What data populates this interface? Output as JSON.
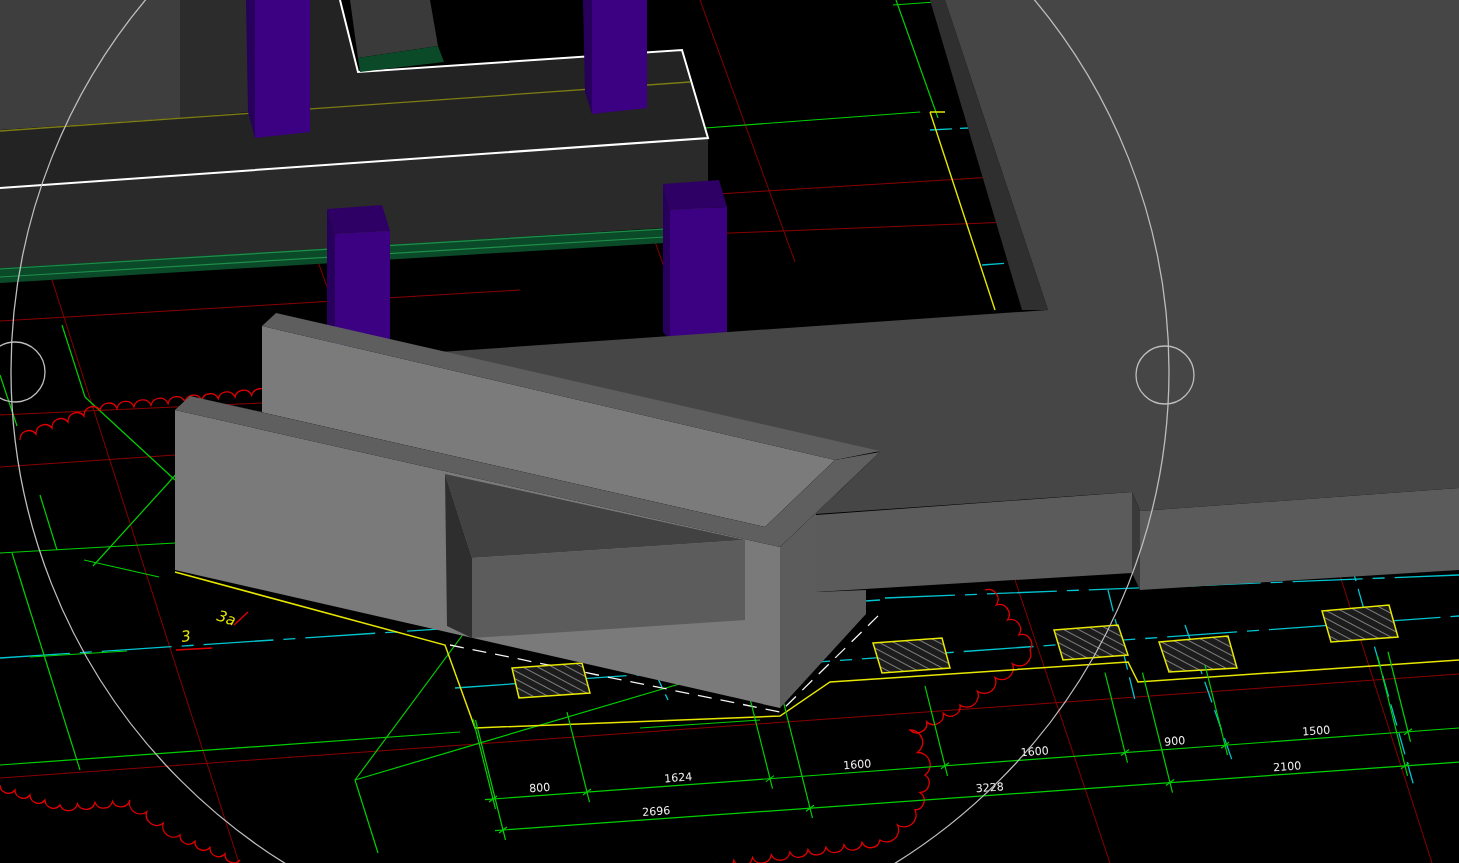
{
  "viewport": {
    "axis_labels": [
      "3a",
      "3"
    ],
    "dimension_chains": [
      {
        "values": [
          "800",
          "1624",
          "1600",
          "1600",
          "900",
          "1500"
        ]
      },
      {
        "values": [
          "2696",
          "3228",
          "2100"
        ]
      }
    ]
  }
}
